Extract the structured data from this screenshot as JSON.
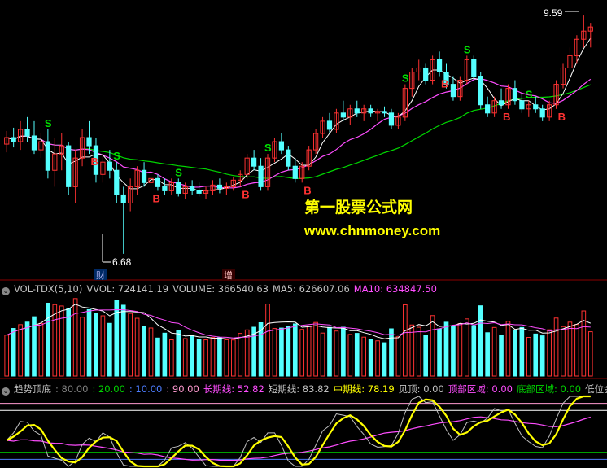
{
  "colors": {
    "up": "#ff3232",
    "down": "#54ffff",
    "ma_white": "#ffffff",
    "ma_magenta": "#ff4dff",
    "ma_green": "#00d600",
    "yellow": "#ffff00",
    "label_gray": "#c0c0c0"
  },
  "price_panel": {
    "high_label": "9.59",
    "low_label": "6.68",
    "event_labels": [
      "财",
      "增"
    ],
    "buy_marker": "B",
    "sell_marker": "S",
    "watermark_title": "第一股票公式网",
    "watermark_url": "www.chnmoney.com"
  },
  "volume_header": {
    "indicator": "VOL-TDX(5,10)",
    "vvol": "VVOL: 724141.19",
    "volume": "VOLUME: 366540.63",
    "ma5": "MA5: 626607.06",
    "ma10": "MA10: 634847.50"
  },
  "trend_header": {
    "name": "趋势顶底",
    "v80": ": 80.00",
    "v20": ": 20.00",
    "v10": ": 10.00",
    "v90": ": 90.00",
    "long": "长期线: 52.82",
    "short": "短期线: 83.82",
    "mid": "中期线: 78.19",
    "top": "见顶: 0.00",
    "top_zone": "顶部区域: 0.00",
    "bottom_zone": "底部区域: 0.00",
    "low_gold": "低位金"
  },
  "chart_data": {
    "type": "candlestick",
    "price_range": [
      6.5,
      9.7
    ],
    "candles_ohlc": [
      [
        8.02,
        8.18,
        7.92,
        8.1
      ],
      [
        8.1,
        8.22,
        7.98,
        8.05
      ],
      [
        8.05,
        8.3,
        7.95,
        8.2
      ],
      [
        8.2,
        8.35,
        8.05,
        8.12
      ],
      [
        8.12,
        8.3,
        7.9,
        7.95
      ],
      [
        7.95,
        8.15,
        7.85,
        8.05
      ],
      [
        8.05,
        8.2,
        7.6,
        7.7
      ],
      [
        7.7,
        8.1,
        7.5,
        7.9
      ],
      [
        7.9,
        8.15,
        7.7,
        8.0
      ],
      [
        8.0,
        8.05,
        7.4,
        7.5
      ],
      [
        7.5,
        7.95,
        7.3,
        7.85
      ],
      [
        7.85,
        8.2,
        7.75,
        8.1
      ],
      [
        8.1,
        8.3,
        7.9,
        8.0
      ],
      [
        8.0,
        8.1,
        7.55,
        7.65
      ],
      [
        7.65,
        7.9,
        7.55,
        7.8
      ],
      [
        7.8,
        7.95,
        7.6,
        7.7
      ],
      [
        7.7,
        7.8,
        7.3,
        7.4
      ],
      [
        7.4,
        7.5,
        6.68,
        7.3
      ],
      [
        7.3,
        7.6,
        7.2,
        7.5
      ],
      [
        7.5,
        7.75,
        7.4,
        7.7
      ],
      [
        7.7,
        7.8,
        7.5,
        7.55
      ],
      [
        7.55,
        7.7,
        7.45,
        7.6
      ],
      [
        7.6,
        7.65,
        7.45,
        7.5
      ],
      [
        7.5,
        7.6,
        7.4,
        7.45
      ],
      [
        7.45,
        7.6,
        7.4,
        7.55
      ],
      [
        7.55,
        7.6,
        7.38,
        7.42
      ],
      [
        7.42,
        7.55,
        7.35,
        7.5
      ],
      [
        7.5,
        7.58,
        7.4,
        7.45
      ],
      [
        7.45,
        7.55,
        7.38,
        7.42
      ],
      [
        7.42,
        7.5,
        7.35,
        7.45
      ],
      [
        7.45,
        7.58,
        7.4,
        7.52
      ],
      [
        7.52,
        7.6,
        7.42,
        7.48
      ],
      [
        7.48,
        7.55,
        7.4,
        7.5
      ],
      [
        7.5,
        7.62,
        7.45,
        7.58
      ],
      [
        7.58,
        7.7,
        7.5,
        7.65
      ],
      [
        7.65,
        7.9,
        7.6,
        7.85
      ],
      [
        7.85,
        7.95,
        7.7,
        7.75
      ],
      [
        7.75,
        7.85,
        7.45,
        7.5
      ],
      [
        7.5,
        7.9,
        7.45,
        7.85
      ],
      [
        7.85,
        8.1,
        7.8,
        8.05
      ],
      [
        8.05,
        8.15,
        7.9,
        7.95
      ],
      [
        7.95,
        8.0,
        7.7,
        7.75
      ],
      [
        7.75,
        7.85,
        7.55,
        7.6
      ],
      [
        7.6,
        7.8,
        7.55,
        7.75
      ],
      [
        7.75,
        8.0,
        7.7,
        7.95
      ],
      [
        7.95,
        8.2,
        7.9,
        8.15
      ],
      [
        8.15,
        8.35,
        8.1,
        8.3
      ],
      [
        8.3,
        8.4,
        8.15,
        8.2
      ],
      [
        8.2,
        8.45,
        8.15,
        8.4
      ],
      [
        8.4,
        8.55,
        8.3,
        8.35
      ],
      [
        8.35,
        8.5,
        8.25,
        8.45
      ],
      [
        8.45,
        8.55,
        8.35,
        8.4
      ],
      [
        8.4,
        8.5,
        8.3,
        8.45
      ],
      [
        8.45,
        8.5,
        8.35,
        8.4
      ],
      [
        8.4,
        8.45,
        8.3,
        8.42
      ],
      [
        8.42,
        8.48,
        8.35,
        8.4
      ],
      [
        8.4,
        8.45,
        8.2,
        8.25
      ],
      [
        8.25,
        8.4,
        8.2,
        8.35
      ],
      [
        8.35,
        8.75,
        8.3,
        8.7
      ],
      [
        8.7,
        8.95,
        8.6,
        8.9
      ],
      [
        8.9,
        9.05,
        8.8,
        8.95
      ],
      [
        8.95,
        9.0,
        8.75,
        8.8
      ],
      [
        8.8,
        9.1,
        8.75,
        9.05
      ],
      [
        9.05,
        9.15,
        8.85,
        8.9
      ],
      [
        8.9,
        9.0,
        8.7,
        8.75
      ],
      [
        8.75,
        8.85,
        8.55,
        8.6
      ],
      [
        8.6,
        8.85,
        8.55,
        8.8
      ],
      [
        8.8,
        9.1,
        8.75,
        9.05
      ],
      [
        9.05,
        9.1,
        8.8,
        8.85
      ],
      [
        8.85,
        8.9,
        8.45,
        8.5
      ],
      [
        8.5,
        8.6,
        8.35,
        8.4
      ],
      [
        8.4,
        8.6,
        8.35,
        8.55
      ],
      [
        8.55,
        8.7,
        8.45,
        8.5
      ],
      [
        8.5,
        8.75,
        8.45,
        8.7
      ],
      [
        8.7,
        8.8,
        8.5,
        8.55
      ],
      [
        8.55,
        8.65,
        8.4,
        8.45
      ],
      [
        8.45,
        8.55,
        8.35,
        8.5
      ],
      [
        8.5,
        8.6,
        8.4,
        8.45
      ],
      [
        8.45,
        8.5,
        8.3,
        8.35
      ],
      [
        8.35,
        8.55,
        8.3,
        8.5
      ],
      [
        8.5,
        8.8,
        8.45,
        8.75
      ],
      [
        8.75,
        9.0,
        8.7,
        8.95
      ],
      [
        8.95,
        9.2,
        8.9,
        9.1
      ],
      [
        9.1,
        9.35,
        9.0,
        9.3
      ],
      [
        9.3,
        9.59,
        9.2,
        9.4
      ],
      [
        9.4,
        9.5,
        9.2,
        9.45
      ]
    ],
    "ma_lines": [
      "white",
      "magenta",
      "green"
    ],
    "volume_panel": {
      "type": "bar",
      "series": [
        "VVOL",
        "MA5",
        "MA10"
      ]
    },
    "trend_panel": {
      "type": "line",
      "levels": [
        80,
        20,
        10,
        90
      ],
      "series": [
        "长期线",
        "短期线",
        "中期线"
      ],
      "last_values": {
        "长期线": 52.82,
        "短期线": 83.82,
        "中期线": 78.19
      }
    }
  }
}
